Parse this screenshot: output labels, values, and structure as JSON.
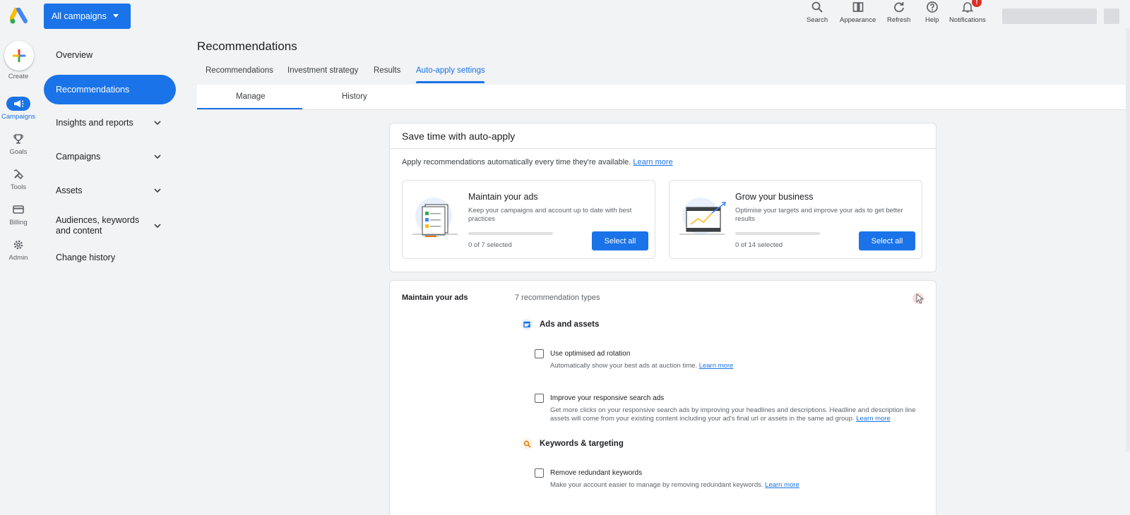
{
  "rail": {
    "create_label": "Create",
    "items": [
      {
        "label": "Campaigns",
        "icon": "megaphone-icon",
        "active": true
      },
      {
        "label": "Goals",
        "icon": "trophy-icon"
      },
      {
        "label": "Tools",
        "icon": "tools-icon"
      },
      {
        "label": "Billing",
        "icon": "credit-card-icon"
      },
      {
        "label": "Admin",
        "icon": "gear-icon"
      }
    ]
  },
  "topbar": {
    "campaign_selector": "All campaigns",
    "actions": [
      {
        "label": "Search",
        "icon": "search-icon"
      },
      {
        "label": "Appearance",
        "icon": "appearance-icon"
      },
      {
        "label": "Refresh",
        "icon": "refresh-icon"
      },
      {
        "label": "Help",
        "icon": "help-icon"
      },
      {
        "label": "Notifications",
        "icon": "bell-icon",
        "badge": "!"
      }
    ]
  },
  "nav": {
    "items": [
      {
        "label": "Overview"
      },
      {
        "label": "Recommendations",
        "active": true
      },
      {
        "label": "Insights and reports",
        "expandable": true
      },
      {
        "label": "Campaigns",
        "expandable": true
      },
      {
        "label": "Assets",
        "expandable": true
      },
      {
        "label": "Audiences, keywords and content",
        "expandable": true
      },
      {
        "label": "Change history"
      }
    ]
  },
  "page": {
    "title": "Recommendations",
    "tabs": [
      "Recommendations",
      "Investment strategy",
      "Results",
      "Auto-apply settings"
    ],
    "active_tab": "Auto-apply settings",
    "subtabs": [
      "Manage",
      "History"
    ],
    "active_subtab": "Manage"
  },
  "autoapply": {
    "title": "Save time with auto-apply",
    "desc": "Apply recommendations automatically every time they're available.",
    "learn_more": "Learn more",
    "cards": [
      {
        "title": "Maintain your ads",
        "text": "Keep your campaigns and account up to date with best practices",
        "count": "0 of 7 selected",
        "button": "Select all",
        "selected_fraction": 0
      },
      {
        "title": "Grow your business",
        "text": "Optimise your targets and improve your ads to get better results",
        "count": "0 of 14 selected",
        "button": "Select all",
        "selected_fraction": 0
      }
    ]
  },
  "maintain": {
    "title": "Maintain your ads",
    "count": "7 recommendation types",
    "groups": [
      {
        "label": "Ads and assets",
        "icon": "ads-assets-icon",
        "color": "#1a73e8"
      },
      {
        "label": "Keywords & targeting",
        "icon": "search-icon",
        "color": "#e37400"
      }
    ],
    "options": [
      {
        "title": "Use optimised ad rotation",
        "desc": "Automatically show your best ads at auction time.",
        "link": "Learn more"
      },
      {
        "title": "Improve your responsive search ads",
        "desc": "Get more clicks on your responsive search ads by improving your headlines and descriptions. Headline and description line assets will come from your existing content including your ad's final url or assets in the same ad group.",
        "link": "Learn more"
      },
      {
        "title": "Remove redundant keywords",
        "desc": "Make your account easier to manage by removing redundant keywords.",
        "link": "Learn more"
      }
    ]
  },
  "colors": {
    "accent": "#1a73e8",
    "badge": "#d93025"
  }
}
